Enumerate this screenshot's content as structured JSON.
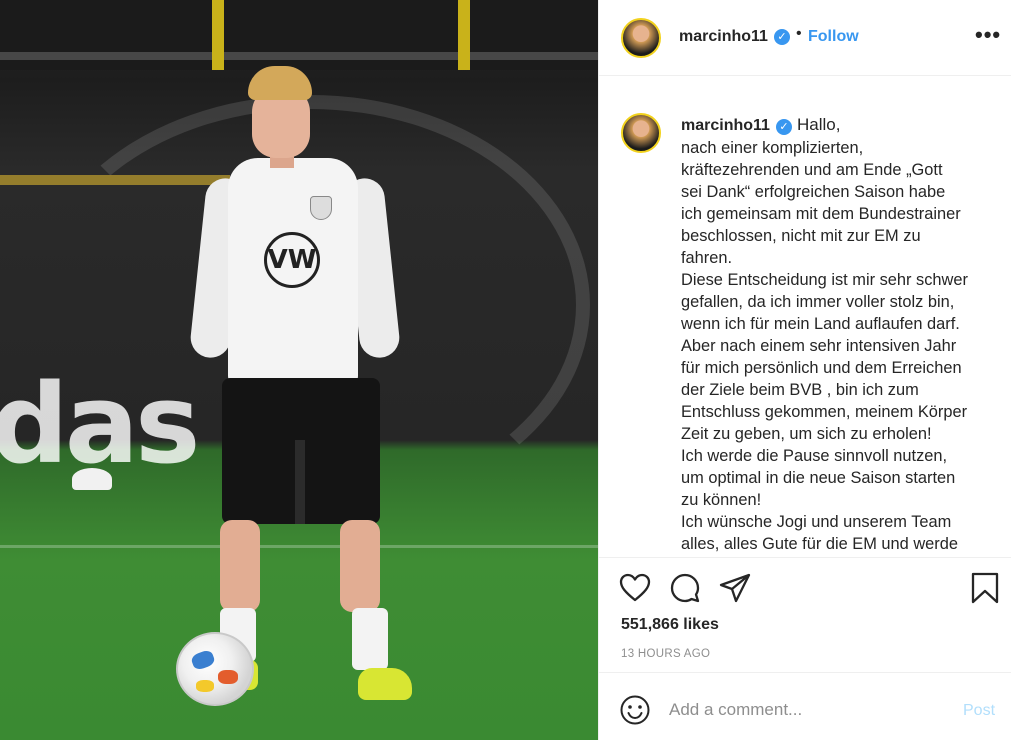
{
  "post": {
    "username": "marcinho11",
    "verified_mark": "✓",
    "separator": "•",
    "follow_label": "Follow",
    "more_label": "•••",
    "caption": {
      "first_line": "Hallo,",
      "lines": [
        "nach einer komplizierten,",
        "kräftezehrenden und am Ende „Gott",
        "sei Dank“ erfolgreichen Saison habe",
        "ich gemeinsam mit dem Bundestrainer",
        "beschlossen, nicht mit zur EM zu",
        "fahren.",
        "Diese Entscheidung ist mir sehr schwer",
        "gefallen, da ich immer voller stolz bin,",
        "wenn ich für mein Land auflaufen darf.",
        "Aber nach einem sehr intensiven Jahr",
        "für mich persönlich und dem Erreichen",
        "der Ziele beim BVB , bin ich zum",
        "Entschluss gekommen, meinem Körper",
        "Zeit zu geben, um sich zu erholen!",
        "Ich werde die Pause sinnvoll nutzen,",
        "um optimal in die neue Saison starten",
        "zu können!",
        "Ich wünsche Jogi und unserem Team",
        "alles, alles Gute für die EM und werde"
      ]
    },
    "likes": "551,866 likes",
    "timestamp": "13 HOURS AGO",
    "comment": {
      "placeholder": "Add a comment...",
      "post_label": "Post"
    },
    "photo_text": {
      "board": "das",
      "jersey_logo": "VW"
    }
  },
  "colors": {
    "accent": "#3897f0",
    "post_disabled": "#b2dffc",
    "muted": "#8e8e8e",
    "text": "#262626"
  },
  "icons": [
    "heart-icon",
    "comment-icon",
    "share-icon",
    "bookmark-icon",
    "smiley-icon",
    "verified-icon",
    "more-icon"
  ]
}
